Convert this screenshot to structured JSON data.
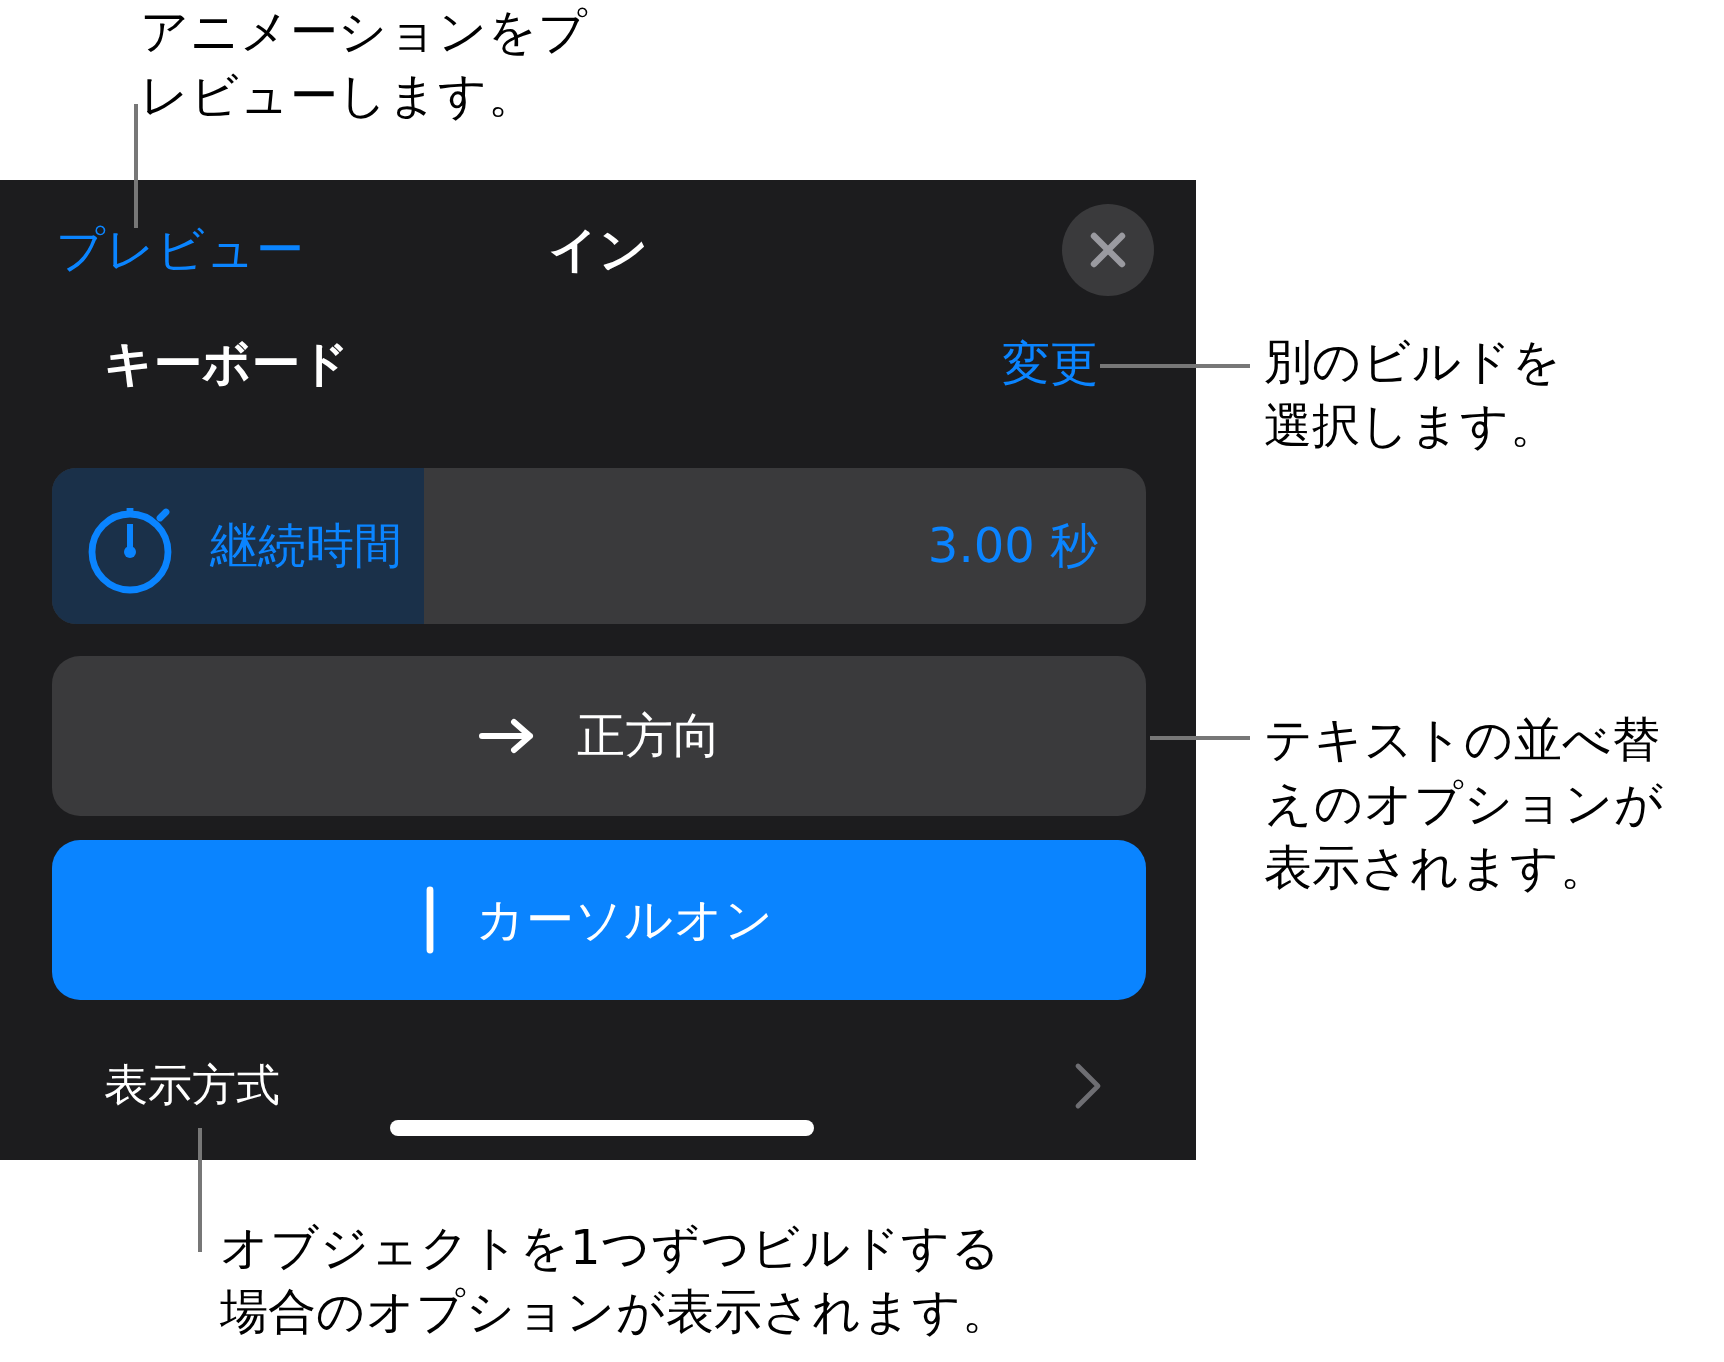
{
  "panel": {
    "preview_link": "プレビュー",
    "title": "イン",
    "build_name": "キーボード",
    "change_link": "変更",
    "duration": {
      "label": "継続時間",
      "reading": "3.00 秒",
      "level": 0.34
    },
    "options": [
      {
        "label": "正方向",
        "kind": "arrow",
        "selected": false
      },
      {
        "label": "カーソルオン",
        "kind": "cursor",
        "selected": true
      }
    ],
    "delivery": {
      "label": "表示方式"
    }
  },
  "callouts": [
    {
      "text": "アニメーションをプレビューします。",
      "kind": "top"
    },
    {
      "text": "別のビルドを選択します。",
      "kind": "right"
    },
    {
      "text": "テキストの並べ替えのオプションが表示されます。",
      "kind": "right"
    },
    {
      "text": "オブジェクトを1つずつビルドする場合のオプションが表示されます。",
      "kind": "bottom"
    }
  ]
}
